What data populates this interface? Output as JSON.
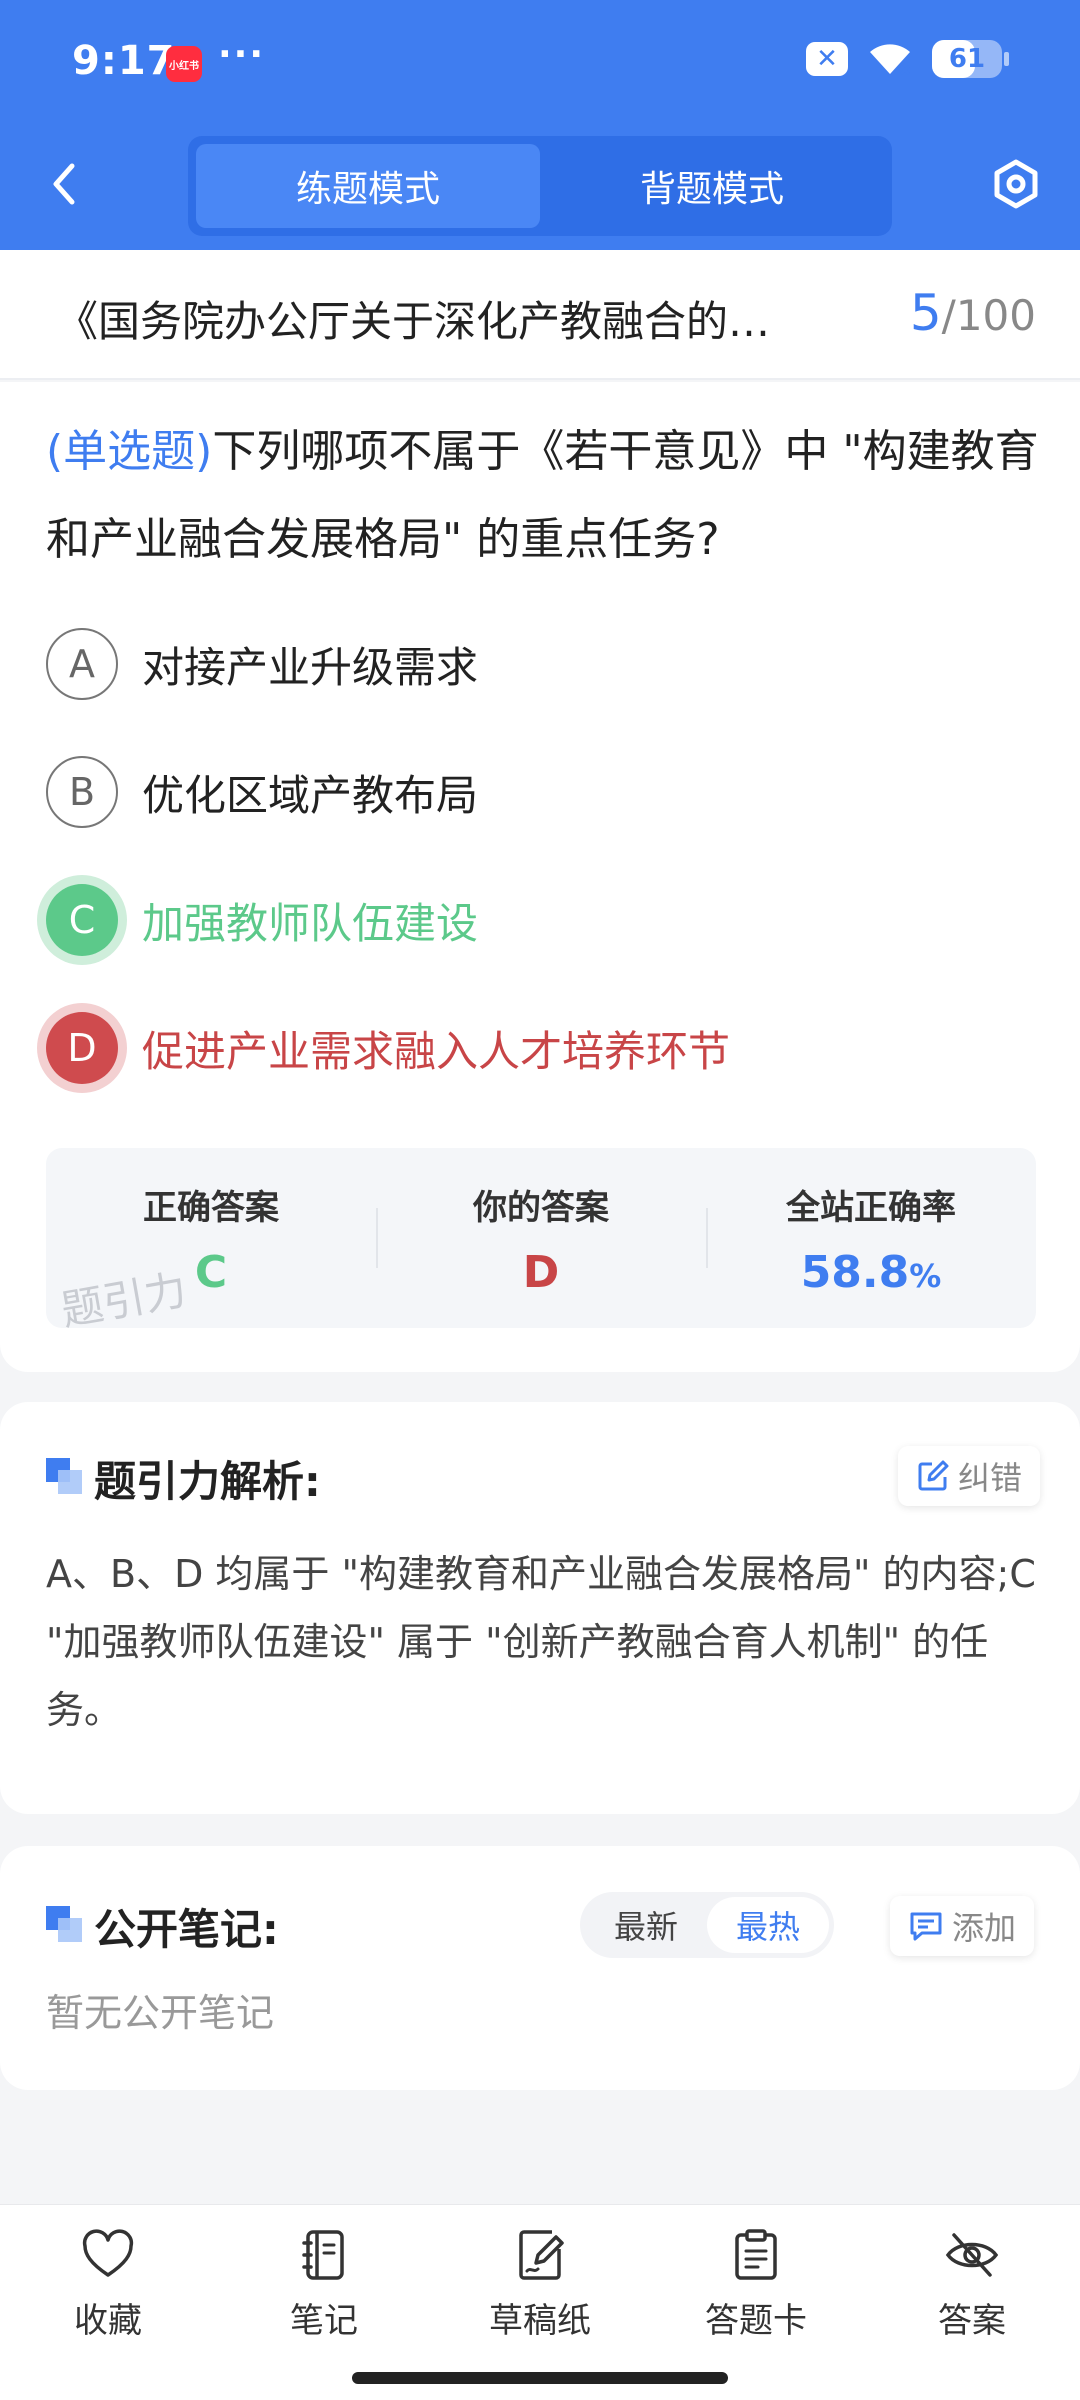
{
  "status_bar": {
    "time": "9:17",
    "app_badge": "小红书",
    "more": "···",
    "battery": "61",
    "battery_level_percent": 61,
    "icons": [
      "sim-off-icon",
      "wifi-icon",
      "battery-icon"
    ]
  },
  "header": {
    "back_icon": "chevron-left-icon",
    "tabs": [
      {
        "label": "练题模式",
        "active": true
      },
      {
        "label": "背题模式",
        "active": false
      }
    ],
    "settings_icon": "hexagon-settings-icon",
    "brand_color": "#3f7df0"
  },
  "document": {
    "title": "《国务院办公厅关于深化产教融合的…",
    "current": "5",
    "separator": "/",
    "total": "100"
  },
  "question": {
    "type": "(单选题)",
    "text": "下列哪项不属于《若干意见》中 \"构建教育和产业融合发展格局\" 的重点任务?",
    "options": [
      {
        "letter": "A",
        "text": "对接产业升级需求",
        "state": "normal"
      },
      {
        "letter": "B",
        "text": "优化区域产教布局",
        "state": "normal"
      },
      {
        "letter": "C",
        "text": "加强教师队伍建设",
        "state": "correct"
      },
      {
        "letter": "D",
        "text": "促进产业需求融入人才培养环节",
        "state": "wrong"
      }
    ],
    "correct_color": "#5cc98a",
    "wrong_color": "#c84547"
  },
  "result": {
    "correct_label": "正确答案",
    "correct_value": "C",
    "your_label": "你的答案",
    "your_value": "D",
    "rate_label": "全站正确率",
    "rate_value": "58.8",
    "rate_unit": "%",
    "watermark": "题引力"
  },
  "analysis": {
    "title": "题引力解析:",
    "correct_button": "纠错",
    "text": "A、B、D 均属于 \"构建教育和产业融合发展格局\" 的内容;C \"加强教师队伍建设\" 属于 \"创新产教融合育人机制\" 的任务。"
  },
  "notes": {
    "title": "公开笔记:",
    "sort_latest": "最新",
    "sort_hot": "最热",
    "add_button": "添加",
    "empty": "暂无公开笔记"
  },
  "bottom_nav": [
    {
      "label": "收藏",
      "icon": "heart-icon"
    },
    {
      "label": "笔记",
      "icon": "notebook-icon"
    },
    {
      "label": "草稿纸",
      "icon": "draft-paper-icon"
    },
    {
      "label": "答题卡",
      "icon": "answer-card-icon"
    },
    {
      "label": "答案",
      "icon": "eye-off-icon"
    }
  ]
}
